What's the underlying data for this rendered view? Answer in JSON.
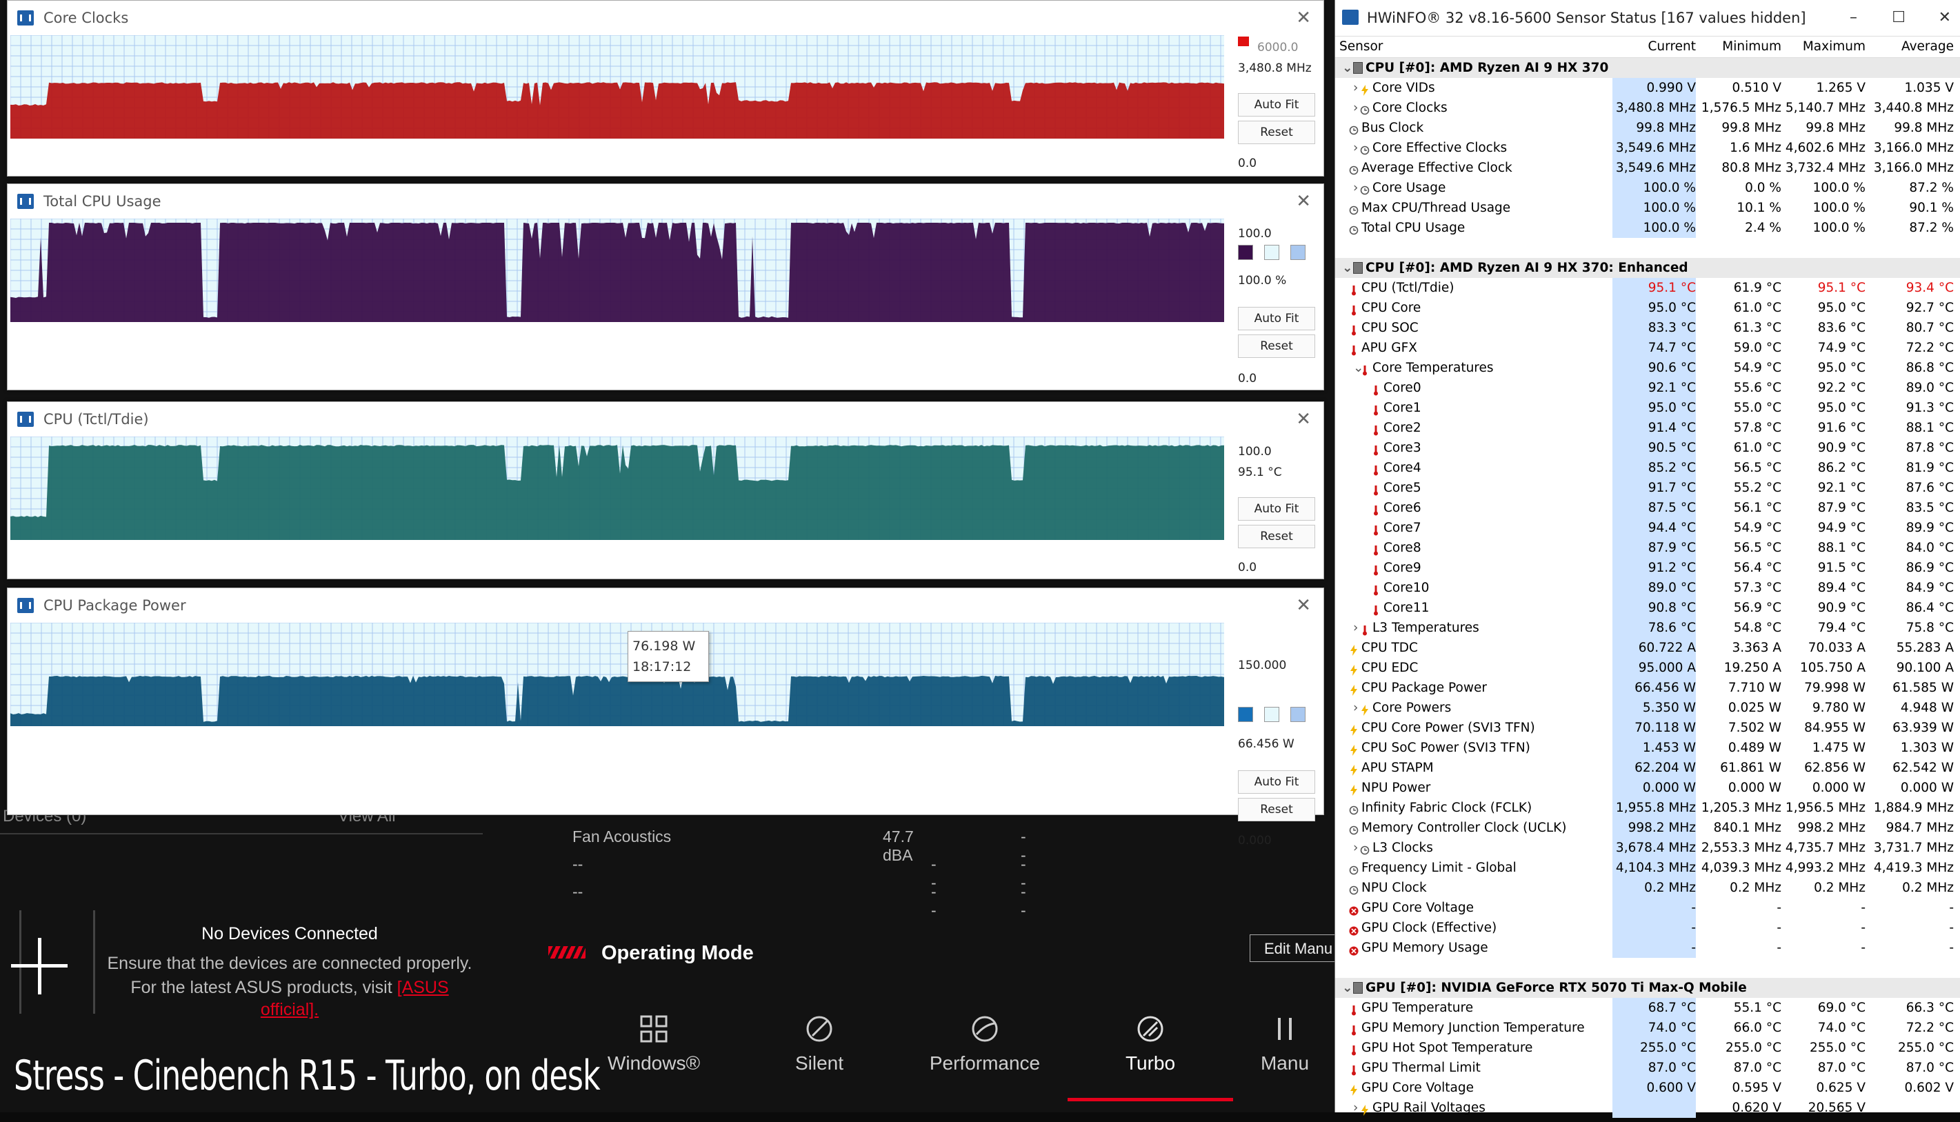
{
  "background": {
    "devices_label": "Devices (0)",
    "view_all": "View All",
    "no_devices": "No Devices Connected",
    "ensure_text": "Ensure that the devices are connected properly.",
    "latest_text": "For the latest ASUS products, visit",
    "asus_link_1": "[ASUS",
    "asus_link_2": "official].",
    "fan_rows": [
      {
        "label": "Fan Acoustics",
        "value": "47.7 dBA",
        "extra": "--"
      },
      {
        "label": "--",
        "value": "- -",
        "extra": "--"
      },
      {
        "label": "--",
        "value": "- -",
        "extra": "--"
      }
    ],
    "operating_mode": "Operating Mode",
    "edit_manual": "Edit Manu",
    "modes": [
      {
        "label": "Windows®",
        "icon": "windows-grid-icon"
      },
      {
        "label": "Silent",
        "icon": "leaf-icon"
      },
      {
        "label": "Performance",
        "icon": "wind-icon"
      },
      {
        "label": "Turbo",
        "icon": "rocket-icon"
      },
      {
        "label": "Manu",
        "icon": "tools-icon"
      }
    ],
    "active_mode": "Turbo",
    "caption": "Stress - Cinebench R15 - Turbo, on desk",
    "accent": "#e4001b"
  },
  "graphs": [
    {
      "id": "core-clocks",
      "title": "Core Clocks",
      "top_value": "6000.0",
      "current_value": "3,480.8 MHz",
      "bottom_value": "0.0",
      "auto_fit": "Auto Fit",
      "reset": "Reset",
      "color": "#b71818",
      "levels": {
        "base": 0.56,
        "dip": 0.38
      }
    },
    {
      "id": "total-cpu-usage",
      "title": "Total CPU Usage",
      "top_value": "100.0",
      "current_value": "100.0 %",
      "bottom_value": "0.0",
      "auto_fit": "Auto Fit",
      "reset": "Reset",
      "color": "#3a0f4a",
      "levels": {
        "base": 1.0,
        "dip": 0.05
      }
    },
    {
      "id": "cpu-tctl",
      "title": "CPU (Tctl/Tdie)",
      "top_value": "100.0",
      "current_value": "95.1 °C",
      "bottom_value": "0.0",
      "auto_fit": "Auto Fit",
      "reset": "Reset",
      "color": "#1f6b69",
      "levels": {
        "base": 0.95,
        "dip": 0.6
      }
    },
    {
      "id": "cpu-package-power",
      "title": "CPU Package Power",
      "top_value": "150.000",
      "current_value": "66.456 W",
      "bottom_value": "0.000",
      "auto_fit": "Auto Fit",
      "reset": "Reset",
      "color": "#11557a",
      "levels": {
        "base": 0.5,
        "dip": 0.05
      }
    }
  ],
  "tooltip": {
    "value": "76.198 W",
    "time": "18:17:12"
  },
  "hwinfo": {
    "title": "HWiNFO® 32 v8.16-5600 Sensor Status [167 values hidden]",
    "columns": [
      "Sensor",
      "Current",
      "Minimum",
      "Maximum",
      "Average"
    ],
    "groups": [
      {
        "name": "CPU [#0]: AMD Ryzen AI 9 HX 370",
        "rows": [
          {
            "n": "Core VIDs",
            "ind": 1,
            "icon": "bolt",
            "exp": true,
            "v": [
              "0.990 V",
              "0.510 V",
              "1.265 V",
              "1.035 V"
            ]
          },
          {
            "n": "Core Clocks",
            "ind": 1,
            "icon": "clock",
            "exp": true,
            "v": [
              "3,480.8 MHz",
              "1,576.5 MHz",
              "5,140.7 MHz",
              "3,440.8 MHz"
            ]
          },
          {
            "n": "Bus Clock",
            "ind": 0,
            "icon": "clock",
            "v": [
              "99.8 MHz",
              "99.8 MHz",
              "99.8 MHz",
              "99.8 MHz"
            ]
          },
          {
            "n": "Core Effective Clocks",
            "ind": 1,
            "icon": "clock",
            "exp": true,
            "v": [
              "3,549.6 MHz",
              "1.6 MHz",
              "4,602.6 MHz",
              "3,166.0 MHz"
            ]
          },
          {
            "n": "Average Effective Clock",
            "ind": 0,
            "icon": "clock",
            "v": [
              "3,549.6 MHz",
              "80.8 MHz",
              "3,732.4 MHz",
              "3,166.0 MHz"
            ]
          },
          {
            "n": "Core Usage",
            "ind": 1,
            "icon": "clock",
            "exp": true,
            "v": [
              "100.0 %",
              "0.0 %",
              "100.0 %",
              "87.2 %"
            ]
          },
          {
            "n": "Max CPU/Thread Usage",
            "ind": 0,
            "icon": "clock",
            "v": [
              "100.0 %",
              "10.1 %",
              "100.0 %",
              "90.1 %"
            ]
          },
          {
            "n": "Total CPU Usage",
            "ind": 0,
            "icon": "clock",
            "v": [
              "100.0 %",
              "2.4 %",
              "100.0 %",
              "87.2 %"
            ]
          }
        ]
      },
      {
        "name": "CPU [#0]: AMD Ryzen AI 9 HX 370: Enhanced",
        "rows": [
          {
            "n": "CPU (Tctl/Tdie)",
            "ind": 0,
            "icon": "therm",
            "hot": true,
            "v": [
              "95.1 °C",
              "61.9 °C",
              "95.1 °C",
              "93.4 °C"
            ]
          },
          {
            "n": "CPU Core",
            "ind": 0,
            "icon": "therm",
            "v": [
              "95.0 °C",
              "61.0 °C",
              "95.0 °C",
              "92.7 °C"
            ]
          },
          {
            "n": "CPU SOC",
            "ind": 0,
            "icon": "therm",
            "v": [
              "83.3 °C",
              "61.3 °C",
              "83.6 °C",
              "80.7 °C"
            ]
          },
          {
            "n": "APU GFX",
            "ind": 0,
            "icon": "therm",
            "v": [
              "74.7 °C",
              "59.0 °C",
              "74.9 °C",
              "72.2 °C"
            ]
          },
          {
            "n": "Core Temperatures",
            "ind": 1,
            "icon": "therm",
            "exp": true,
            "open": true,
            "v": [
              "90.6 °C",
              "54.9 °C",
              "95.0 °C",
              "86.8 °C"
            ]
          },
          {
            "n": "Core0",
            "ind": 2,
            "icon": "therm",
            "v": [
              "92.1 °C",
              "55.6 °C",
              "92.2 °C",
              "89.0 °C"
            ]
          },
          {
            "n": "Core1",
            "ind": 2,
            "icon": "therm",
            "v": [
              "95.0 °C",
              "55.0 °C",
              "95.0 °C",
              "91.3 °C"
            ]
          },
          {
            "n": "Core2",
            "ind": 2,
            "icon": "therm",
            "v": [
              "91.4 °C",
              "57.8 °C",
              "91.6 °C",
              "88.1 °C"
            ]
          },
          {
            "n": "Core3",
            "ind": 2,
            "icon": "therm",
            "v": [
              "90.5 °C",
              "61.0 °C",
              "90.9 °C",
              "87.8 °C"
            ]
          },
          {
            "n": "Core4",
            "ind": 2,
            "icon": "therm",
            "v": [
              "85.2 °C",
              "56.5 °C",
              "86.2 °C",
              "81.9 °C"
            ]
          },
          {
            "n": "Core5",
            "ind": 2,
            "icon": "therm",
            "v": [
              "91.7 °C",
              "55.2 °C",
              "92.1 °C",
              "87.6 °C"
            ]
          },
          {
            "n": "Core6",
            "ind": 2,
            "icon": "therm",
            "v": [
              "87.5 °C",
              "56.1 °C",
              "87.9 °C",
              "83.5 °C"
            ]
          },
          {
            "n": "Core7",
            "ind": 2,
            "icon": "therm",
            "v": [
              "94.4 °C",
              "54.9 °C",
              "94.9 °C",
              "89.9 °C"
            ]
          },
          {
            "n": "Core8",
            "ind": 2,
            "icon": "therm",
            "v": [
              "87.9 °C",
              "56.5 °C",
              "88.1 °C",
              "84.0 °C"
            ]
          },
          {
            "n": "Core9",
            "ind": 2,
            "icon": "therm",
            "v": [
              "91.2 °C",
              "56.4 °C",
              "91.5 °C",
              "86.9 °C"
            ]
          },
          {
            "n": "Core10",
            "ind": 2,
            "icon": "therm",
            "v": [
              "89.0 °C",
              "57.3 °C",
              "89.4 °C",
              "84.9 °C"
            ]
          },
          {
            "n": "Core11",
            "ind": 2,
            "icon": "therm",
            "v": [
              "90.8 °C",
              "56.9 °C",
              "90.9 °C",
              "86.4 °C"
            ]
          },
          {
            "n": "L3 Temperatures",
            "ind": 1,
            "icon": "therm",
            "exp": true,
            "v": [
              "78.6 °C",
              "54.8 °C",
              "79.4 °C",
              "75.8 °C"
            ]
          },
          {
            "n": "CPU TDC",
            "ind": 0,
            "icon": "bolt",
            "v": [
              "60.722 A",
              "3.363 A",
              "70.033 A",
              "55.283 A"
            ]
          },
          {
            "n": "CPU EDC",
            "ind": 0,
            "icon": "bolt",
            "v": [
              "95.000 A",
              "19.250 A",
              "105.750 A",
              "90.100 A"
            ]
          },
          {
            "n": "CPU Package Power",
            "ind": 0,
            "icon": "bolt",
            "v": [
              "66.456 W",
              "7.710 W",
              "79.998 W",
              "61.585 W"
            ]
          },
          {
            "n": "Core Powers",
            "ind": 1,
            "icon": "bolt",
            "exp": true,
            "v": [
              "5.350 W",
              "0.025 W",
              "9.780 W",
              "4.948 W"
            ]
          },
          {
            "n": "CPU Core Power (SVI3 TFN)",
            "ind": 0,
            "icon": "bolt",
            "v": [
              "70.118 W",
              "7.502 W",
              "84.955 W",
              "63.939 W"
            ]
          },
          {
            "n": "CPU SoC Power (SVI3 TFN)",
            "ind": 0,
            "icon": "bolt",
            "v": [
              "1.453 W",
              "0.489 W",
              "1.475 W",
              "1.303 W"
            ]
          },
          {
            "n": "APU STAPM",
            "ind": 0,
            "icon": "bolt",
            "v": [
              "62.204 W",
              "61.861 W",
              "62.856 W",
              "62.542 W"
            ]
          },
          {
            "n": "NPU Power",
            "ind": 0,
            "icon": "bolt",
            "v": [
              "0.000 W",
              "0.000 W",
              "0.000 W",
              "0.000 W"
            ]
          },
          {
            "n": "Infinity Fabric Clock (FCLK)",
            "ind": 0,
            "icon": "clock",
            "v": [
              "1,955.8 MHz",
              "1,205.3 MHz",
              "1,956.5 MHz",
              "1,884.9 MHz"
            ]
          },
          {
            "n": "Memory Controller Clock (UCLK)",
            "ind": 0,
            "icon": "clock",
            "v": [
              "998.2 MHz",
              "840.1 MHz",
              "998.2 MHz",
              "984.7 MHz"
            ]
          },
          {
            "n": "L3 Clocks",
            "ind": 1,
            "icon": "clock",
            "exp": true,
            "v": [
              "3,678.4 MHz",
              "2,553.3 MHz",
              "4,735.7 MHz",
              "3,731.7 MHz"
            ]
          },
          {
            "n": "Frequency Limit - Global",
            "ind": 0,
            "icon": "clock",
            "v": [
              "4,104.3 MHz",
              "4,039.3 MHz",
              "4,993.2 MHz",
              "4,419.3 MHz"
            ]
          },
          {
            "n": "NPU Clock",
            "ind": 0,
            "icon": "clock",
            "v": [
              "0.2 MHz",
              "0.2 MHz",
              "0.2 MHz",
              "0.2 MHz"
            ]
          },
          {
            "n": "GPU Core Voltage",
            "ind": 0,
            "icon": "x",
            "v": [
              "-",
              "-",
              "-",
              "-"
            ]
          },
          {
            "n": "GPU Clock (Effective)",
            "ind": 0,
            "icon": "x",
            "v": [
              "-",
              "-",
              "-",
              "-"
            ]
          },
          {
            "n": "GPU Memory Usage",
            "ind": 0,
            "icon": "x",
            "v": [
              "-",
              "-",
              "-",
              "-"
            ]
          }
        ]
      },
      {
        "name": "GPU [#0]: NVIDIA  GeForce RTX 5070 Ti Max-Q Mobile",
        "rows": [
          {
            "n": "GPU Temperature",
            "ind": 0,
            "icon": "therm",
            "v": [
              "68.7 °C",
              "55.1 °C",
              "69.0 °C",
              "66.3 °C"
            ]
          },
          {
            "n": "GPU Memory Junction Temperature",
            "ind": 0,
            "icon": "therm",
            "v": [
              "74.0 °C",
              "66.0 °C",
              "74.0 °C",
              "72.2 °C"
            ]
          },
          {
            "n": "GPU Hot Spot Temperature",
            "ind": 0,
            "icon": "therm",
            "v": [
              "255.0 °C",
              "255.0 °C",
              "255.0 °C",
              "255.0 °C"
            ]
          },
          {
            "n": "GPU Thermal Limit",
            "ind": 0,
            "icon": "therm",
            "v": [
              "87.0 °C",
              "87.0 °C",
              "87.0 °C",
              "87.0 °C"
            ]
          },
          {
            "n": "GPU Core Voltage",
            "ind": 0,
            "icon": "bolt",
            "v": [
              "0.600 V",
              "0.595 V",
              "0.625 V",
              "0.602 V"
            ]
          },
          {
            "n": "GPU Rail Voltages",
            "ind": 1,
            "icon": "bolt",
            "exp": true,
            "v": [
              "",
              "0.620 V",
              "20.565 V",
              ""
            ]
          }
        ]
      }
    ]
  }
}
